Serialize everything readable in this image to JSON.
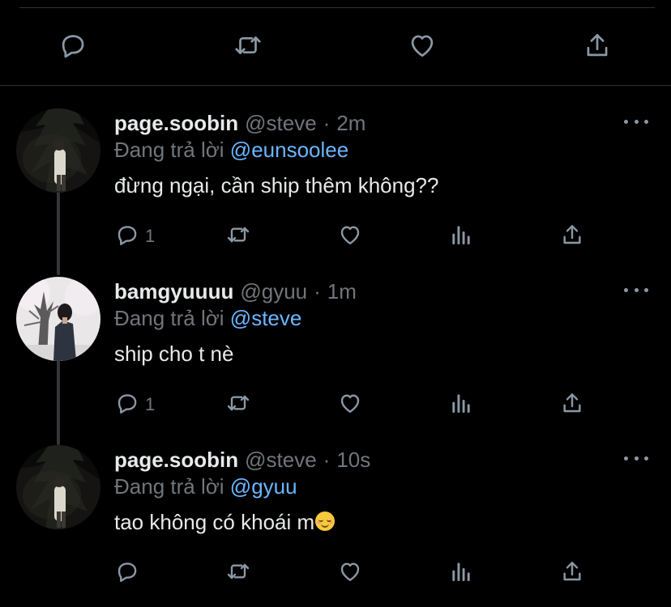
{
  "top_actions": [
    {
      "icon": "reply-icon",
      "label": "Reply"
    },
    {
      "icon": "retweet-icon",
      "label": "Retweet"
    },
    {
      "icon": "like-icon",
      "label": "Like"
    },
    {
      "icon": "share-icon",
      "label": "Share"
    }
  ],
  "tweets": [
    {
      "display_name": "page.soobin",
      "handle": "@steve",
      "separator": "·",
      "time": "2m",
      "reply_prefix": "Đang trả lời",
      "reply_to": "@eunsoolee",
      "text": "đừng ngại, cần ship thêm không??",
      "reply_count": "1",
      "more_icon": "more-icon"
    },
    {
      "display_name": "bamgyuuuu",
      "handle": "@gyuu",
      "separator": "·",
      "time": "1m",
      "reply_prefix": "Đang trả lời",
      "reply_to": "@steve",
      "text": "ship cho t nè",
      "reply_count": "1",
      "more_icon": "more-icon"
    },
    {
      "display_name": "page.soobin",
      "handle": "@steve",
      "separator": "·",
      "time": "10s",
      "reply_prefix": "Đang trả lời",
      "reply_to": "@gyuu",
      "text": "tao không có khoái m",
      "text_emoji": "smiling-face-emoji",
      "reply_count": "",
      "more_icon": "more-icon"
    }
  ],
  "colors": {
    "background": "#000000",
    "text": "#e7e9ea",
    "muted": "#71767b",
    "link": "#6cb6ff",
    "divider": "#2f3336"
  }
}
